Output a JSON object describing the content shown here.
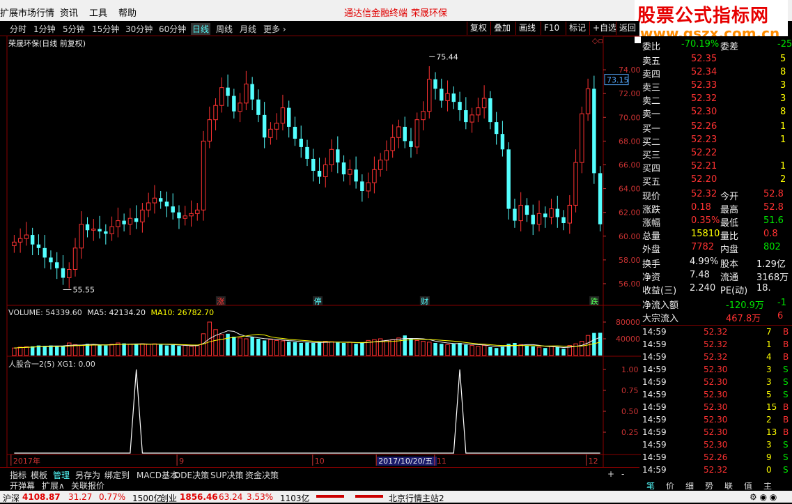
{
  "menu": {
    "items": [
      "扩展市场行情",
      "资讯",
      "工具",
      "帮助"
    ],
    "center": [
      "通达信金融终端",
      "荣晟环保"
    ]
  },
  "watermark": {
    "line1": "股票公式指标网",
    "line2": "www.gszx.com.cn"
  },
  "periods": [
    "分时",
    "1分钟",
    "5分钟",
    "15分钟",
    "30分钟",
    "60分钟",
    "日线",
    "周线",
    "月线",
    "更多 ›"
  ],
  "active_period": "日线",
  "right_buttons": [
    "复权",
    "叠加",
    "画线",
    "F10",
    "标记",
    "+自选",
    "返回"
  ],
  "main_title": "荣晟环保(日线 前复权)",
  "high_label": "75.44",
  "low_label": "55.55",
  "current_price_tag": "73.15",
  "event_marks": [
    "涨",
    "停",
    "财",
    "跌"
  ],
  "volume_header": {
    "label": "VOLUME: 54339.60",
    "ma5": "MA5: 42134.20",
    "ma10": "MA10: 26782.70"
  },
  "indicator_header": "人股合一2(5) XG1: 0.00",
  "date_axis": [
    "2017年",
    "9",
    "10",
    "2017/10/20/五",
    "11",
    "12"
  ],
  "bottom_tabs": [
    "指标",
    "模板",
    "管理",
    "另存为",
    "绑定到",
    "MACD基本",
    "DDE决策",
    "SUP决策",
    "资金决策"
  ],
  "bottom_tabs2": [
    "开弹幕",
    "扩展∧",
    "关联报价"
  ],
  "right_bottom_tabs": [
    "笔",
    "价",
    "细",
    "势",
    "联",
    "值",
    "主"
  ],
  "quote": {
    "weibi_label": "委比",
    "weibi": "-70.19%",
    "weicha_label": "委差",
    "weicha": "-25",
    "asks": [
      {
        "label": "卖五",
        "price": "52.35",
        "vol": "5"
      },
      {
        "label": "卖四",
        "price": "52.34",
        "vol": "8"
      },
      {
        "label": "卖三",
        "price": "52.33",
        "vol": "3"
      },
      {
        "label": "卖二",
        "price": "52.32",
        "vol": "3"
      },
      {
        "label": "卖一",
        "price": "52.30",
        "vol": "8"
      }
    ],
    "bids": [
      {
        "label": "买一",
        "price": "52.26",
        "vol": "1"
      },
      {
        "label": "买二",
        "price": "52.23",
        "vol": "1"
      },
      {
        "label": "买三",
        "price": "52.22",
        "vol": ""
      },
      {
        "label": "买四",
        "price": "52.21",
        "vol": "1"
      },
      {
        "label": "买五",
        "price": "52.20",
        "vol": "2"
      }
    ],
    "stats": [
      {
        "l1": "现价",
        "v1": "52.32",
        "c1": "red",
        "l2": "今开",
        "v2": "52.8",
        "c2": "red"
      },
      {
        "l1": "涨跌",
        "v1": "0.18",
        "c1": "red",
        "l2": "最高",
        "v2": "52.8",
        "c2": "red"
      },
      {
        "l1": "涨幅",
        "v1": "0.35%",
        "c1": "red",
        "l2": "最低",
        "v2": "51.6",
        "c2": "green"
      },
      {
        "l1": "总量",
        "v1": "15810",
        "c1": "yellow",
        "l2": "量比",
        "v2": "0.8",
        "c2": "red"
      },
      {
        "l1": "外盘",
        "v1": "7782",
        "c1": "red",
        "l2": "内盘",
        "v2": "802",
        "c2": "green"
      }
    ],
    "stats2": [
      {
        "l1": "换手",
        "v1": "4.99%",
        "l2": "股本",
        "v2": "1.29亿"
      },
      {
        "l1": "净资",
        "v1": "7.48",
        "l2": "流通",
        "v2": "3168万"
      },
      {
        "l1": "收益(三)",
        "v1": "2.240",
        "l2": "PE(动)",
        "v2": "18."
      }
    ],
    "flow": [
      {
        "label": "净流入额",
        "v1": "-120.9万",
        "v2": "-1",
        "c": "green"
      },
      {
        "label": "大宗流入",
        "v1": "467.8万",
        "v2": "6",
        "c": "red"
      }
    ],
    "ticks": [
      {
        "t": "14:59",
        "p": "52.32",
        "v": "7",
        "d": "B"
      },
      {
        "t": "14:59",
        "p": "52.32",
        "v": "1",
        "d": "B"
      },
      {
        "t": "14:59",
        "p": "52.32",
        "v": "4",
        "d": "B"
      },
      {
        "t": "14:59",
        "p": "52.30",
        "v": "3",
        "d": "S"
      },
      {
        "t": "14:59",
        "p": "52.30",
        "v": "3",
        "d": "S"
      },
      {
        "t": "14:59",
        "p": "52.30",
        "v": "5",
        "d": "S"
      },
      {
        "t": "14:59",
        "p": "52.30",
        "v": "15",
        "d": "B"
      },
      {
        "t": "14:59",
        "p": "52.30",
        "v": "2",
        "d": "B"
      },
      {
        "t": "14:59",
        "p": "52.30",
        "v": "13",
        "d": "B"
      },
      {
        "t": "14:59",
        "p": "52.30",
        "v": "3",
        "d": "S"
      },
      {
        "t": "14:59",
        "p": "52.26",
        "v": "9",
        "d": "S"
      },
      {
        "t": "14:59",
        "p": "52.32",
        "v": "0",
        "d": "S"
      }
    ]
  },
  "status": {
    "sh_label": "沪深",
    "sh_val": "4108.87",
    "sh_chg": "31.27",
    "sh_pct": "0.77%",
    "sh_amt": "1500亿",
    "cy_label": "创业",
    "cy_val": "1856.46",
    "cy_chg": "63.24",
    "cy_pct": "3.53%",
    "cy_amt": "1103亿",
    "server": "北京行情主站2"
  },
  "chart_data": {
    "type": "candlestick",
    "ylim": [
      55,
      76
    ],
    "yticks": [
      "74.00",
      "72.00",
      "70.00",
      "68.00",
      "66.00",
      "64.00",
      "62.00",
      "60.00",
      "58.00",
      "56.00"
    ],
    "vol_ticks": [
      "80000",
      "40000"
    ],
    "ind_ticks": [
      "1.00",
      "0.75",
      "0.50",
      "0.25"
    ],
    "closes": [
      59.5,
      59.8,
      60.1,
      59.3,
      59.0,
      58.2,
      57.8,
      57.3,
      56.5,
      57.2,
      59.0,
      61.0,
      60.5,
      60.6,
      60.4,
      60.2,
      60.8,
      61.3,
      61.0,
      61.5,
      61.2,
      62.2,
      62.8,
      63.2,
      62.9,
      62.5,
      62.0,
      61.5,
      61.7,
      61.9,
      62.2,
      68.0,
      69.8,
      71.0,
      72.5,
      71.8,
      70.5,
      71.2,
      72.8,
      71.5,
      70.2,
      68.3,
      69.0,
      69.5,
      70.8,
      69.2,
      68.2,
      67.5,
      66.5,
      65.5,
      65.0,
      66.0,
      67.3,
      66.2,
      65.2,
      65.6,
      64.6,
      63.8,
      64.5,
      65.6,
      66.4,
      67.2,
      68.3,
      69.2,
      68.0,
      67.5,
      69.8,
      70.5,
      73.2,
      72.4,
      71.4,
      72.0,
      71.3,
      70.6,
      69.6,
      70.2,
      70.8,
      71.6,
      69.6,
      68.6,
      67.3,
      62.3,
      61.3,
      62.6,
      61.8,
      61.0,
      61.9,
      61.6,
      62.3,
      61.6,
      61.1,
      62.6,
      66.2,
      70.3,
      72.4,
      65.3,
      61.0
    ],
    "vols": [
      18000,
      20000,
      21000,
      22000,
      24000,
      23000,
      24000,
      22000,
      23000,
      30000,
      26000,
      24000,
      28000,
      26000,
      25000,
      24000,
      27000,
      30000,
      29000,
      27000,
      26000,
      28000,
      27000,
      28000,
      26000,
      24000,
      25000,
      23000,
      24000,
      22000,
      24000,
      52000,
      80000,
      62000,
      50000,
      52000,
      45000,
      42000,
      40000,
      44000,
      40000,
      36000,
      38000,
      36000,
      35000,
      33000,
      32000,
      30000,
      31000,
      30000,
      32000,
      34000,
      33000,
      31000,
      30000,
      32000,
      28000,
      30000,
      36000,
      38000,
      40000,
      36000,
      38000,
      42000,
      48000,
      40000,
      36000,
      34000,
      32000,
      30000,
      28000,
      26000,
      28000,
      30000,
      26000,
      24000,
      22000,
      24000,
      20000,
      18000,
      22000,
      28000,
      30000,
      26000,
      24000,
      22000,
      20000,
      18000,
      22000,
      20000,
      16000,
      24000,
      28000,
      34000,
      48000,
      54000,
      54340
    ],
    "signal_at": [
      20,
      73
    ]
  }
}
